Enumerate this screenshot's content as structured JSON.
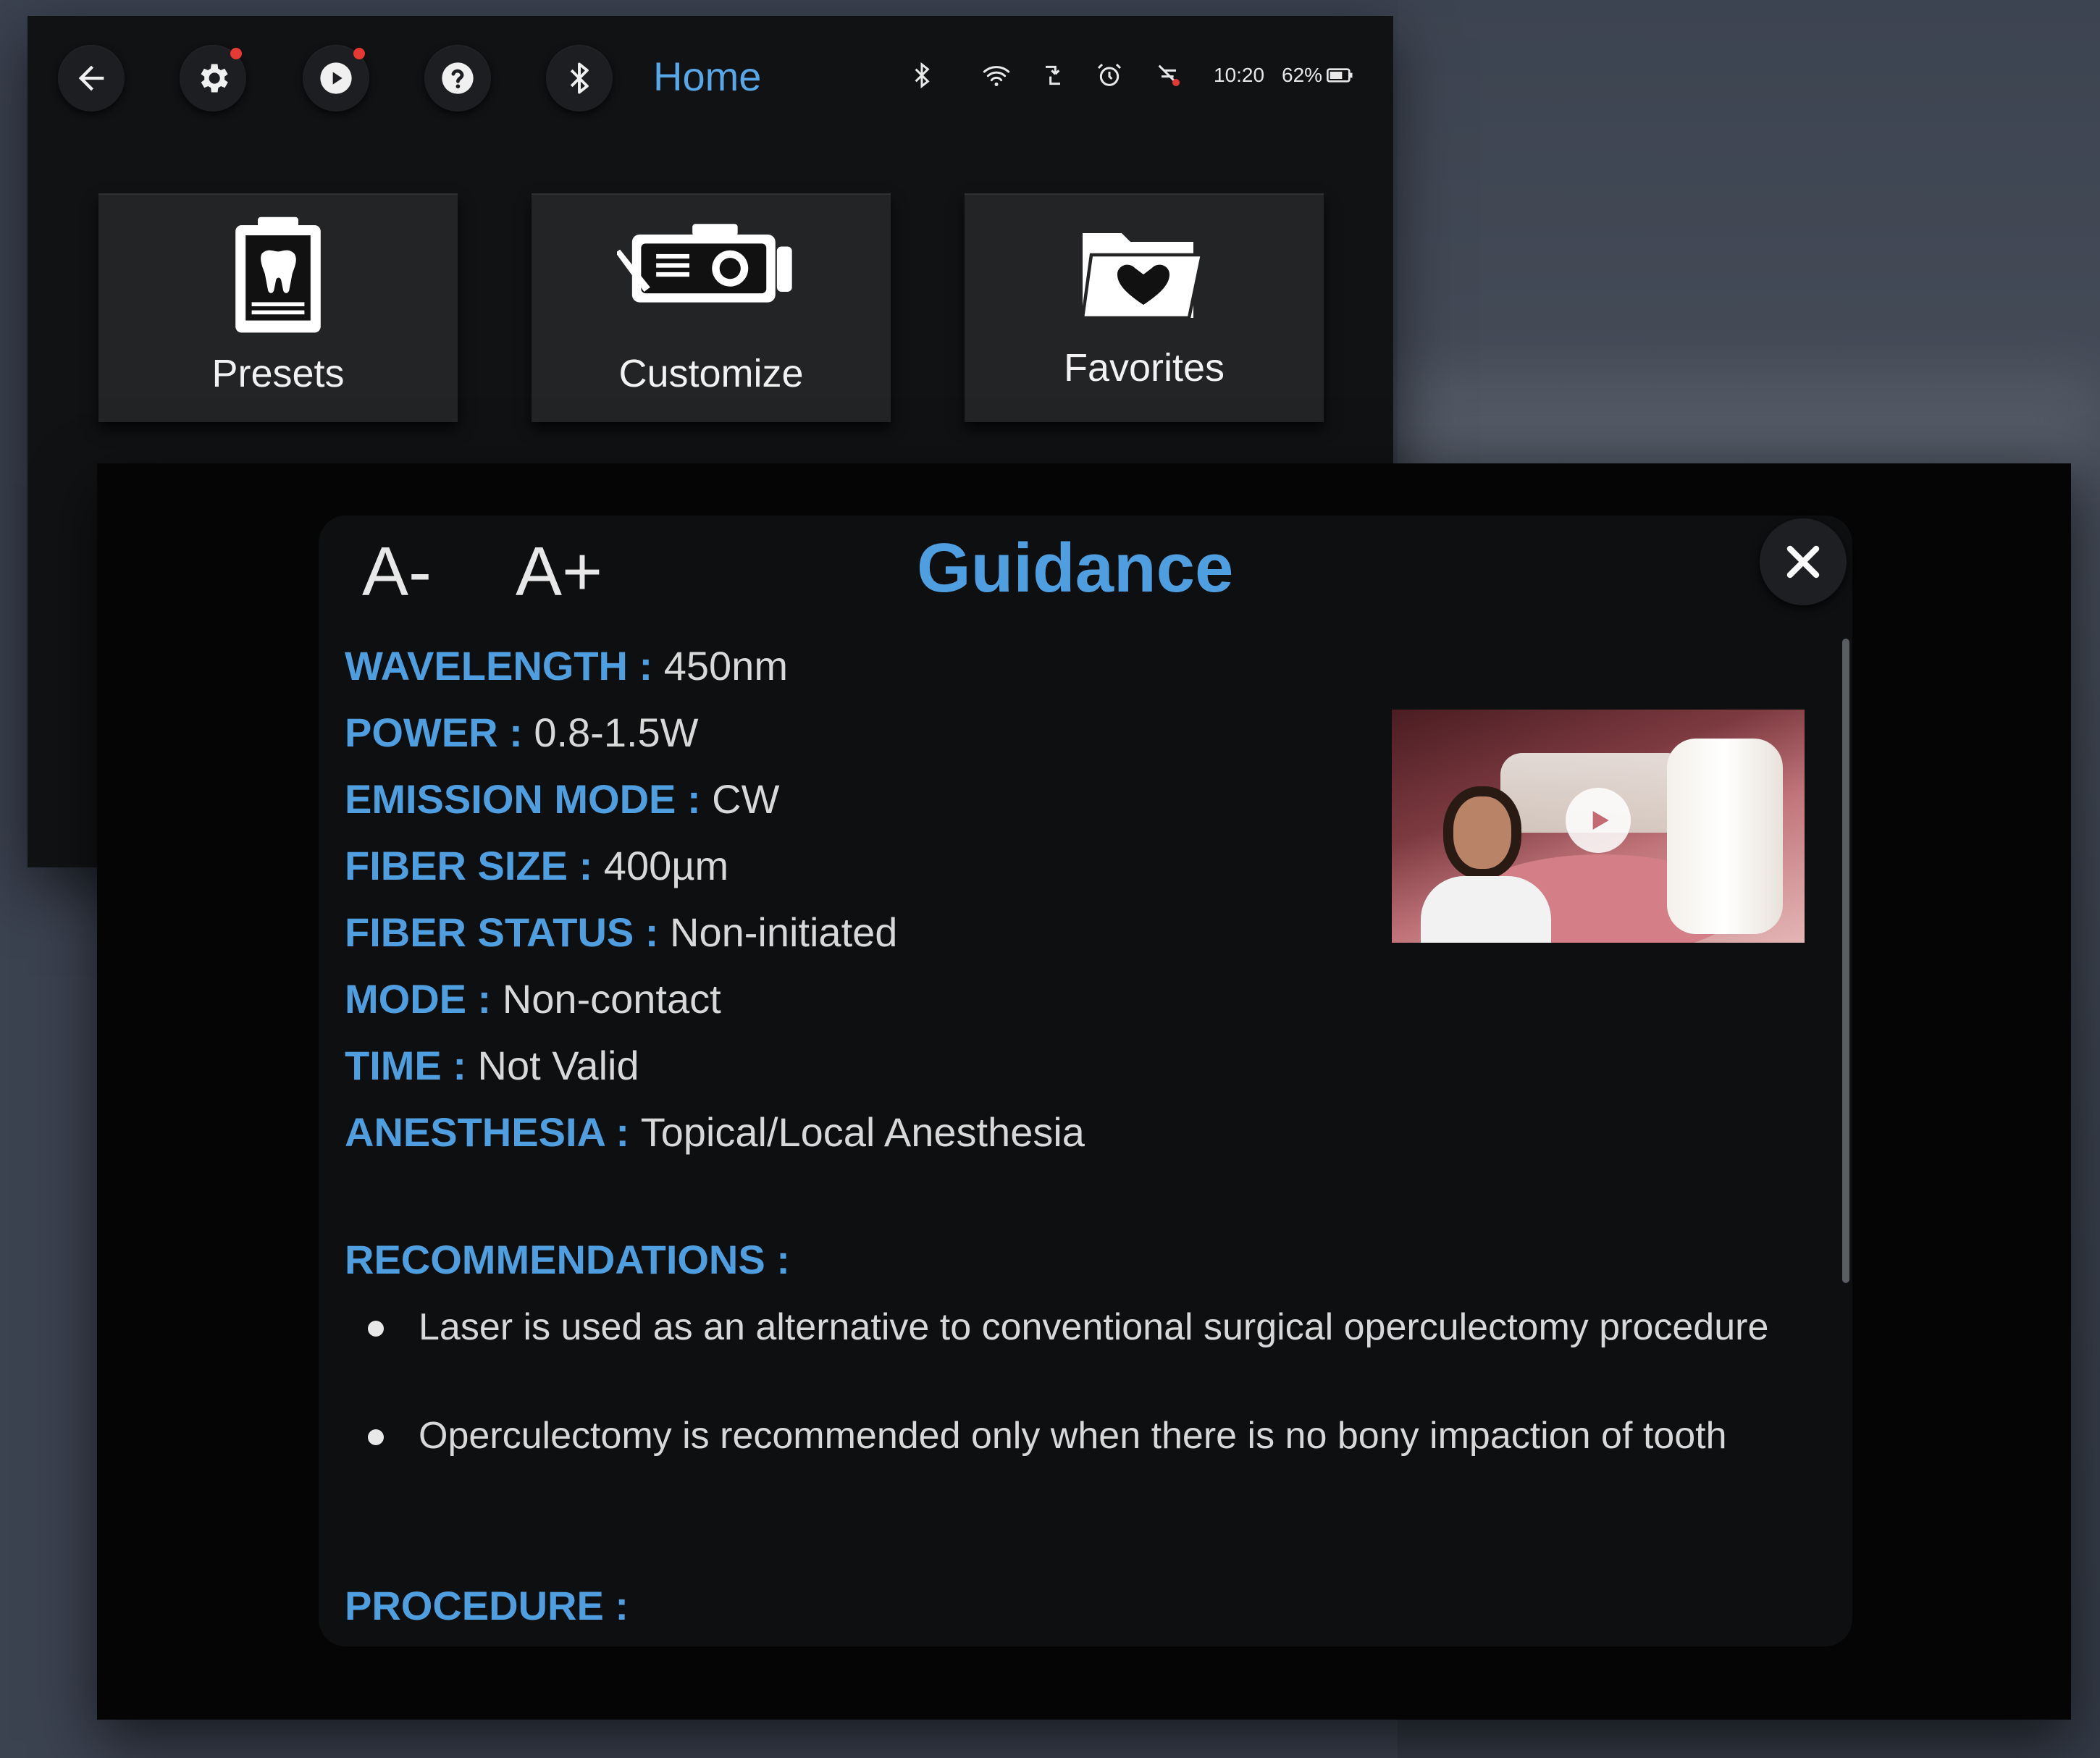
{
  "topbar": {
    "title": "Home",
    "time": "10:20",
    "battery": "62%",
    "buttons": [
      "back-icon",
      "gear-icon",
      "play-icon",
      "help-icon",
      "bluetooth-icon"
    ],
    "status_icons": [
      "bluetooth-icon",
      "wifi-icon",
      "usb-icon",
      "alarm-icon",
      "no-charge-icon",
      "battery-icon"
    ]
  },
  "tiles": [
    {
      "label": "Presets",
      "icon": "tooth-clipboard-icon"
    },
    {
      "label": "Customize",
      "icon": "device-edit-icon"
    },
    {
      "label": "Favorites",
      "icon": "heart-folder-icon"
    }
  ],
  "guidance": {
    "font_minus": "A-",
    "font_plus": "A+",
    "title": "Guidance",
    "params": [
      {
        "label": "WAVELENGTH : ",
        "value": "450nm"
      },
      {
        "label": "POWER : ",
        "value": "0.8-1.5W"
      },
      {
        "label": "EMISSION MODE : ",
        "value": "CW"
      },
      {
        "label": "FIBER SIZE : ",
        "value": "400µm"
      },
      {
        "label": "FIBER STATUS : ",
        "value": "Non-initiated"
      },
      {
        "label": "MODE : ",
        "value": "Non-contact"
      },
      {
        "label": "TIME : ",
        "value": "Not Valid"
      },
      {
        "label": "ANESTHESIA : ",
        "value": "Topical/Local Anesthesia"
      }
    ],
    "recommendations_heading": "RECOMMENDATIONS :",
    "recommendations": [
      "Laser is used as an alternative to conventional surgical operculectomy procedure",
      "Operculectomy is recommended only when there is no bony impaction of tooth"
    ],
    "procedure_heading": "PROCEDURE :"
  },
  "colors": {
    "accent": "#4f9fe0",
    "background": "#111214",
    "tile": "#232426",
    "notification": "#e53935"
  }
}
